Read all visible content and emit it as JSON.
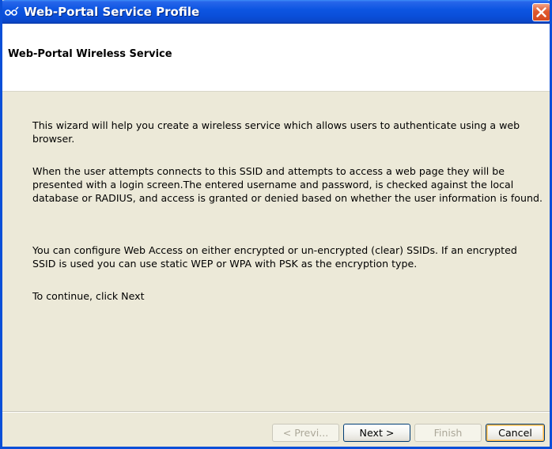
{
  "window": {
    "title": "Web-Portal Service Profile",
    "icon": "service-profile-icon",
    "close_icon": "close-icon",
    "accent_color": "#0a4ed8",
    "close_color": "#e0592f"
  },
  "header": {
    "title": "Web-Portal Wireless Service"
  },
  "content": {
    "paragraphs": [
      "This wizard will help you create a wireless service which allows users to authenticate using a web browser.",
      "When the user attempts connects to this SSID and attempts to access a web page they will be presented with a login screen.The entered username and password, is checked against the local database or RADIUS, and access is granted or denied based on whether the user information is found.",
      "You can configure Web Access on either encrypted or un-encrypted (clear) SSIDs. If an encrypted SSID is used you can use static WEP or WPA with PSK as the encryption type.",
      "To continue, click Next"
    ]
  },
  "buttons": {
    "previous": {
      "label": "< Previ...",
      "enabled": false
    },
    "next": {
      "label": "Next >",
      "enabled": true
    },
    "finish": {
      "label": "Finish",
      "enabled": false
    },
    "cancel": {
      "label": "Cancel",
      "enabled": true,
      "focused": true
    }
  }
}
